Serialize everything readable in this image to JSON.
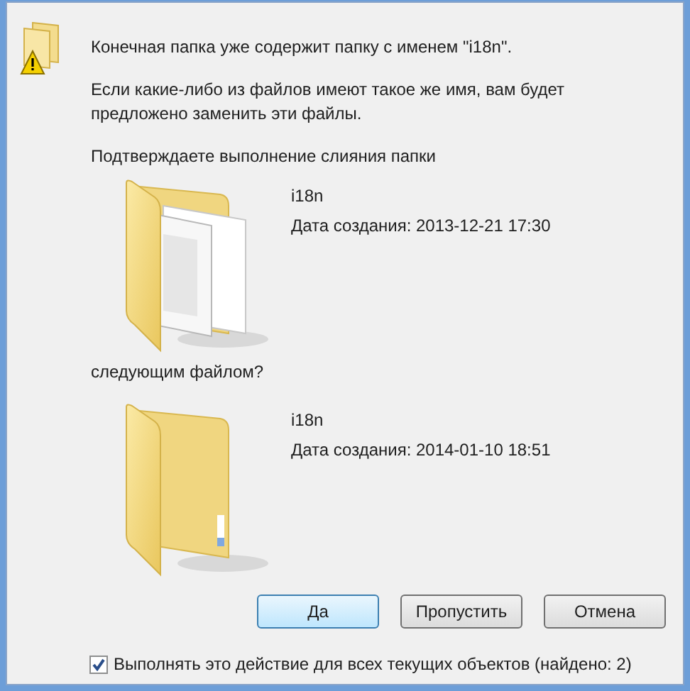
{
  "message": {
    "heading": "Конечная папка уже содержит папку с именем \"i18n\".",
    "detail": "Если какие-либо из файлов имеют такое же имя, вам будет предложено заменить эти файлы.",
    "question": "Подтверждаете выполнение слияния папки"
  },
  "items": [
    {
      "kind": "full",
      "name": "i18n",
      "date": "Дата создания: 2013-12-21 17:30"
    },
    {
      "kind": "empty",
      "name": "i18n",
      "date": "Дата создания: 2014-01-10 18:51"
    }
  ],
  "connector": "следующим файлом?",
  "buttons": [
    {
      "label": "Да",
      "selected": true
    },
    {
      "label": "Пропустить",
      "selected": false
    },
    {
      "label": "Отмена",
      "selected": false
    }
  ],
  "apply_all": {
    "label": "Выполнять это действие для всех текущих объектов (найдено: 2)",
    "checked": true
  }
}
